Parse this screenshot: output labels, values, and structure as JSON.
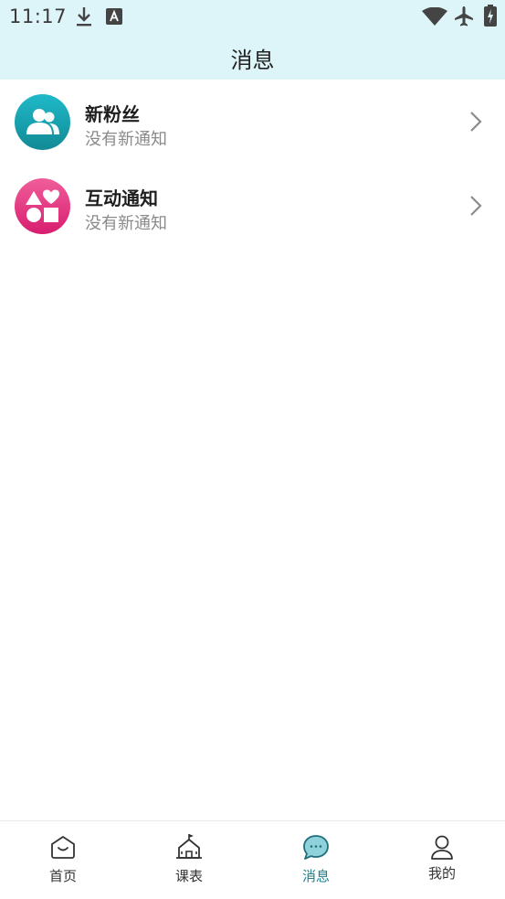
{
  "status_bar": {
    "time": "11:17",
    "icons": [
      "download-icon",
      "text-a-icon",
      "wifi-icon",
      "airplane-icon",
      "battery-charging-icon"
    ]
  },
  "header": {
    "title": "消息",
    "background": "#ddf5f8"
  },
  "messages": [
    {
      "title": "新粉丝",
      "subtitle": "没有新通知",
      "icon": "followers-icon",
      "color_top": "#1fb9c9",
      "color_bottom": "#118a95"
    },
    {
      "title": "互动通知",
      "subtitle": "没有新通知",
      "icon": "shapes-icon",
      "color_top": "#f05e9a",
      "color_bottom": "#d81d6f"
    }
  ],
  "tabbar": {
    "items": [
      {
        "label": "首页",
        "icon": "home-icon",
        "active": false
      },
      {
        "label": "课表",
        "icon": "schoolhouse-icon",
        "active": false
      },
      {
        "label": "消息",
        "icon": "chat-bubble-icon",
        "active": true
      },
      {
        "label": "我的",
        "icon": "user-icon",
        "active": false
      }
    ],
    "active_color": "#1f7f8a"
  }
}
